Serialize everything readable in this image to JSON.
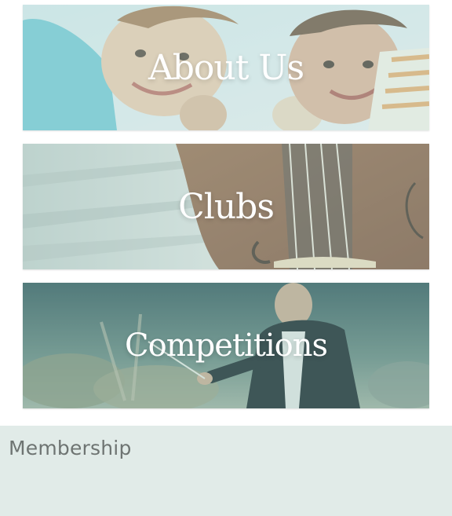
{
  "tiles": {
    "about": {
      "label": "About Us"
    },
    "clubs": {
      "label": "Clubs"
    },
    "competitions": {
      "label": "Competitions"
    }
  },
  "membership": {
    "heading": "Membership"
  },
  "colors": {
    "tile_overlay": "#c4e4e0",
    "membership_bg": "#e1ebe8",
    "membership_text": "#6e7472",
    "title_text": "#ffffff"
  }
}
